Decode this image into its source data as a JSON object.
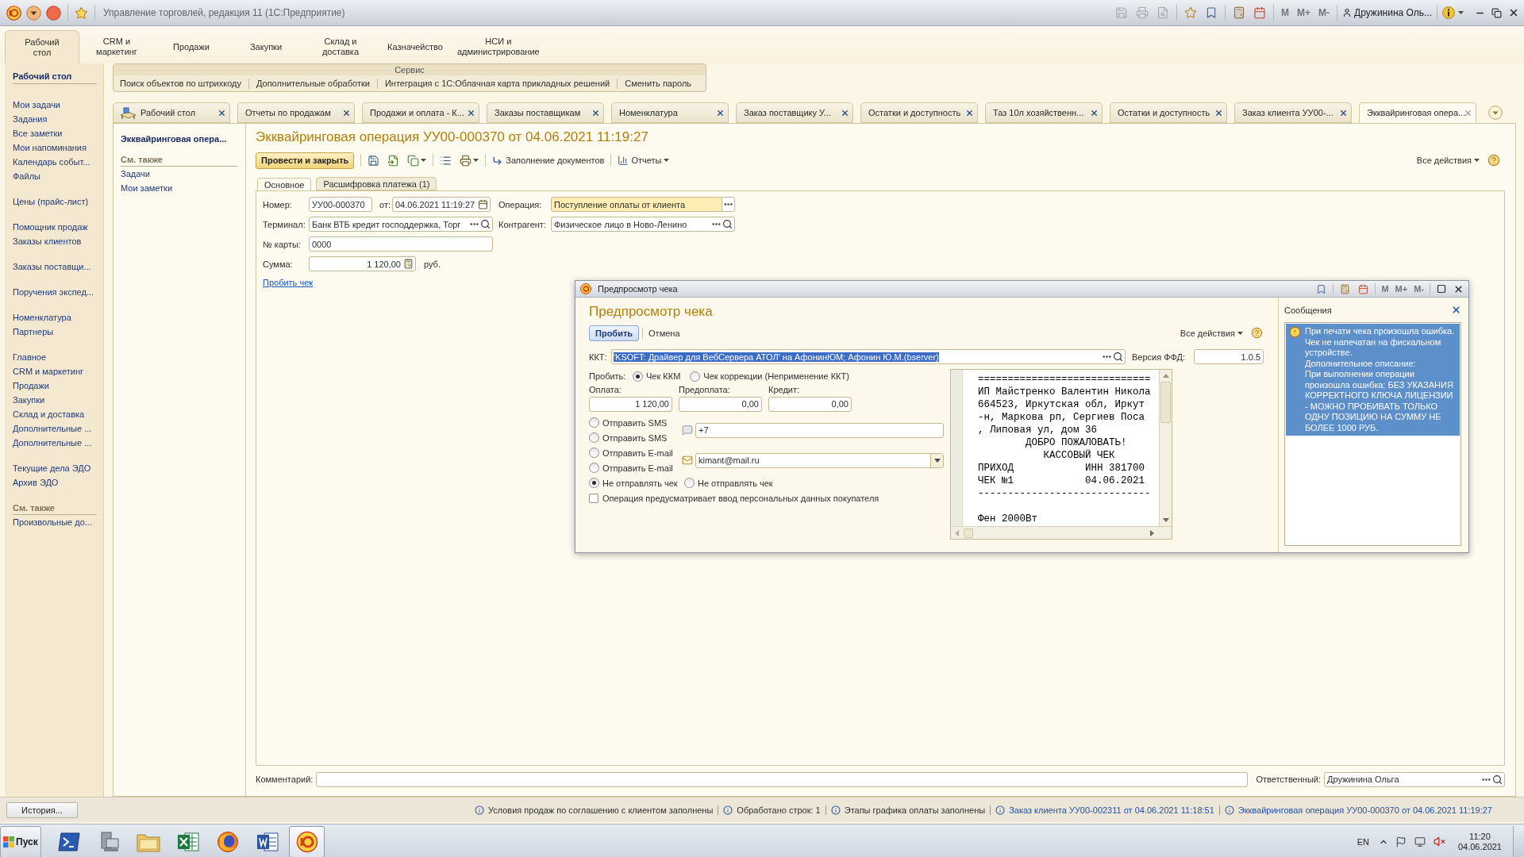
{
  "window": {
    "title": "Управление торговлей, редакция 11 (1С:Предприятие)",
    "quick_icon_groups": [
      {
        "icons": [
          {
            "kind": "save",
            "disabled": true
          },
          {
            "kind": "print",
            "disabled": true
          },
          {
            "kind": "preview",
            "disabled": true
          }
        ]
      },
      {
        "icons": [
          {
            "kind": "add-favorite",
            "disabled": false
          },
          {
            "kind": "favorites",
            "disabled": false
          }
        ]
      },
      {
        "icons": [
          {
            "kind": "calculator",
            "disabled": false
          },
          {
            "kind": "calendar",
            "disabled": false
          }
        ]
      }
    ],
    "memory_buttons": [
      {
        "label": "M",
        "disabled": true
      },
      {
        "label": "M+",
        "disabled": true
      },
      {
        "label": "M-",
        "disabled": true
      }
    ],
    "user": "Дружинина Оль..."
  },
  "sections": [
    {
      "lines": [
        "Рабочий",
        "стол"
      ],
      "selected": true
    },
    {
      "lines": [
        "CRM и",
        "маркетинг"
      ],
      "selected": false
    },
    {
      "lines": [
        "Продажи"
      ],
      "selected": false
    },
    {
      "lines": [
        "Закупки"
      ],
      "selected": false
    },
    {
      "lines": [
        "Склад и",
        "доставка"
      ],
      "selected": false
    },
    {
      "lines": [
        "Казначейство"
      ],
      "selected": false
    },
    {
      "lines": [
        "НСИ и",
        "администрирование"
      ],
      "selected": false
    }
  ],
  "sidebar": {
    "title": "Рабочий стол",
    "groups": [
      {
        "items": [
          "Мои задачи",
          "Задания",
          "Все заметки",
          "Мои напоминания",
          "Календарь событ...",
          "Файлы"
        ]
      },
      {
        "items": [
          "Цены (прайс-лист)"
        ]
      },
      {
        "items": [
          "Помощник продаж",
          "Заказы клиентов"
        ]
      },
      {
        "items": [
          "Заказы поставщи..."
        ]
      },
      {
        "items": [
          "Поручения экспед..."
        ]
      },
      {
        "items": [
          "Номенклатура",
          "Партнеры"
        ]
      },
      {
        "items": [
          "Главное",
          "CRM и маркетинг",
          "Продажи",
          "Закупки",
          "Склад и доставка",
          "Дополнительные ...",
          "Дополнительные ..."
        ]
      },
      {
        "items": [
          "Текущие дела ЭДО",
          "Архив ЭДО"
        ]
      }
    ],
    "see_also": {
      "title": "См. также",
      "items": [
        "Произвольные до..."
      ]
    }
  },
  "service_panel": {
    "title": "Сервис",
    "items": [
      "Поиск объектов по штрихкоду",
      "Дополнительные обработки",
      "Интеграция с 1С:Облачная карта прикладных решений",
      "Сменить пароль"
    ]
  },
  "open_tabs": [
    {
      "label": "Рабочий стол",
      "kind": "home",
      "selected": false
    },
    {
      "label": "Отчеты по продажам",
      "kind": "page",
      "selected": false
    },
    {
      "label": "Продажи и оплата - К...",
      "kind": "page",
      "selected": false
    },
    {
      "label": "Заказы поставщикам",
      "kind": "page",
      "selected": false
    },
    {
      "label": "Номенклатура",
      "kind": "page",
      "selected": false
    },
    {
      "label": "Заказ поставщику У...",
      "kind": "page",
      "selected": false
    },
    {
      "label": "Остатки и доступность",
      "kind": "page",
      "selected": false
    },
    {
      "label": "Таз 10л хозяйственн...",
      "kind": "page",
      "selected": false
    },
    {
      "label": "Остатки и доступность",
      "kind": "page",
      "selected": false
    },
    {
      "label": "Заказ клиента УУ00-...",
      "kind": "page",
      "selected": false
    },
    {
      "label": "Экквайринговая опера...",
      "kind": "page",
      "selected": true
    }
  ],
  "form_nav": {
    "current": "Экквайринговая опера...",
    "see_also": {
      "title": "См. также",
      "items": [
        "Задачи",
        "Мои заметки"
      ]
    }
  },
  "form": {
    "title": "Экквайринговая операция УУ00-000370 от 04.06.2021 11:19:27",
    "toolbar": {
      "primary": "Провести и закрыть",
      "fill": "Заполнение документов",
      "reports": "Отчеты",
      "all_actions": "Все действия"
    },
    "tabs": [
      {
        "label": "Основное",
        "selected": true
      },
      {
        "label": "Расшифровка платежа (1)",
        "selected": false
      }
    ],
    "fields": {
      "number": {
        "label": "Номер:",
        "value": "УУ00-000370"
      },
      "date": {
        "label": "от:",
        "value": "04.06.2021 11:19:27"
      },
      "operation": {
        "label": "Операция:",
        "value": "Поступление оплаты от клиента",
        "focused": true
      },
      "terminal": {
        "label": "Терминал:",
        "value": "Банк ВТБ кредит господдержка, Торг"
      },
      "counterparty": {
        "label": "Контрагент:",
        "value": "Физическое лицо в Ново-Ленино"
      },
      "card": {
        "label": "№ карты:",
        "value": "0000"
      },
      "amount": {
        "label": "Сумма:",
        "value": "1 120,00",
        "unit": "руб."
      }
    },
    "link": "Пробить чек",
    "comment": {
      "label": "Комментарий:"
    },
    "responsible": {
      "label": "Ответственный:",
      "value": "Дружинина Ольга"
    }
  },
  "receipt_dialog": {
    "window_title": "Предпросмотр чека",
    "memory_buttons": [
      {
        "label": "M",
        "disabled": true
      },
      {
        "label": "M+",
        "disabled": true
      },
      {
        "label": "M-",
        "disabled": true
      }
    ],
    "heading": "Предпросмотр чека",
    "buttons": [
      {
        "label": "Пробить",
        "kind": "default"
      },
      {
        "label": "Отмена",
        "kind": "plain"
      }
    ],
    "all_actions": "Все действия",
    "kkt": {
      "label": "ККТ:",
      "value": "'KSOFT: Драйвер для ВебСервера АТОЛ' на АфонинЮМ; Афонин Ю.М.(bserver)",
      "selected": true
    },
    "ffd": {
      "label": "Версия ФФД:",
      "value": "1.0.5"
    },
    "print_mode": {
      "label": "Пробить:",
      "options": [
        {
          "label": "Чек ККМ",
          "selected": true
        },
        {
          "label": "Чек коррекции (Неприменение ККТ)",
          "selected": false
        }
      ]
    },
    "amounts": [
      {
        "label": "Оплата:",
        "value": "1 120,00"
      },
      {
        "label": "Предоплата:",
        "value": "0,00"
      },
      {
        "label": "Кредит:",
        "value": "0,00"
      }
    ],
    "send": {
      "sms_options": [
        {
          "label": "Отправить SMS",
          "selected": false
        },
        {
          "label": "Отправить SMS",
          "selected": false
        }
      ],
      "phone": "+7",
      "email_options": [
        {
          "label": "Отправить E-mail",
          "selected": false
        },
        {
          "label": "Отправить E-mail",
          "selected": false
        }
      ],
      "email": "kimant@mail.ru",
      "none_options": [
        {
          "label": "Не отправлять чек",
          "selected": true
        },
        {
          "label": "Не отправлять чек",
          "selected": false
        }
      ]
    },
    "personal_data": {
      "label": "Операция предусматривает ввод персональных данных покупателя",
      "checked": false
    },
    "receipt": {
      "header_lines": [
        "=============================",
        "ИП Майстренко Валентин Никола",
        "664523, Иркутская обл, Иркут",
        "-н, Маркова рп, Сергиев Поса",
        ", Липовая ул, дом 36",
        "        ДОБРО ПОЖАЛОВАТЬ!",
        "           КАССОВЫЙ ЧЕК",
        "ПРИХОД            ИНН 381700",
        "ЧЕК №1            04.06.2021",
        "-----------------------------"
      ],
      "item_lines": [
        "Фен 2000Вт"
      ]
    },
    "messages": {
      "title": "Сообщения",
      "items": [
        {
          "text": "При печати чека произошла ошибка.\nЧек не напечатан на фискальном устройстве.\nДополнительное описание:\nПри выполнении операции произошла ошибка: БЕЗ УКАЗАНИЯ КОРРЕКТНОГО КЛЮЧА ЛИЦЕНЗИИ - МОЖНО ПРОБИВАТЬ ТОЛЬКО ОДНУ ПОЗИЦИЮ НА СУММУ НЕ БОЛЕЕ 1000 РУБ.",
          "selected": true
        }
      ]
    }
  },
  "status_bar": {
    "history_button": "История...",
    "messages": [
      {
        "text": "Условия продаж по соглашению с клиентом заполнены",
        "kind": "text"
      },
      {
        "text": "Обработано строк: 1",
        "kind": "text"
      },
      {
        "text": "Этапы графика оплаты заполнены",
        "kind": "text"
      },
      {
        "text": "Заказ клиента УУ00-002311 от 04.06.2021 11:18:51",
        "kind": "link"
      },
      {
        "text": "Экквайринговая операция УУ00-000370 от 04.06.2021 11:19:27",
        "kind": "link"
      }
    ]
  },
  "taskbar": {
    "start": "Пуск",
    "apps": [
      {
        "kind": "terminal",
        "active": false
      },
      {
        "kind": "computer",
        "active": false
      },
      {
        "kind": "folder",
        "active": false
      },
      {
        "kind": "spreadsheet",
        "active": false
      },
      {
        "kind": "browser",
        "active": false
      },
      {
        "kind": "text-document",
        "active": false
      },
      {
        "kind": "onec",
        "active": true
      }
    ],
    "language": "EN",
    "time": "11:20",
    "date": "04.06.2021"
  }
}
